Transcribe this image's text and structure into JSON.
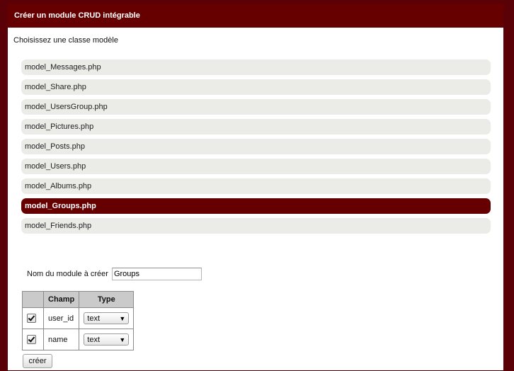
{
  "header": {
    "title": "Créer un module CRUD intégrable"
  },
  "subtitle": "Choisissez une classe modèle",
  "models": [
    {
      "label": "model_Messages.php",
      "selected": false
    },
    {
      "label": "model_Share.php",
      "selected": false
    },
    {
      "label": "model_UsersGroup.php",
      "selected": false
    },
    {
      "label": "model_Pictures.php",
      "selected": false
    },
    {
      "label": "model_Posts.php",
      "selected": false
    },
    {
      "label": "model_Users.php",
      "selected": false
    },
    {
      "label": "model_Albums.php",
      "selected": false
    },
    {
      "label": "model_Groups.php",
      "selected": true
    },
    {
      "label": "model_Friends.php",
      "selected": false
    }
  ],
  "form": {
    "module_name_label": "Nom du module à créer",
    "module_name_value": "Groups",
    "table": {
      "headers": {
        "checkbox": "",
        "champ": "Champ",
        "type": "Type"
      },
      "rows": [
        {
          "checked": true,
          "champ": "user_id",
          "type": "text"
        },
        {
          "checked": true,
          "champ": "name",
          "type": "text"
        }
      ]
    },
    "submit_label": "créer"
  },
  "colors": {
    "accent": "#660000",
    "list_item_bg": "#ebebe8",
    "page_bg": "#5a0007"
  },
  "icons": {
    "select_arrow": "chevron-down-icon",
    "checkbox": "checkmark-icon"
  }
}
